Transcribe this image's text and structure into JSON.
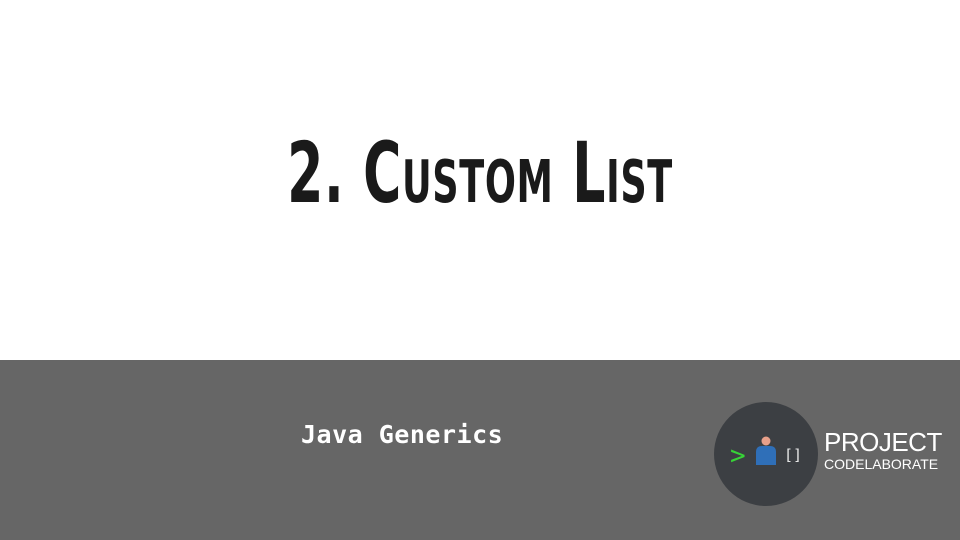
{
  "slide": {
    "title": "2. Custom List",
    "subtitle": "Java Generics"
  },
  "logo": {
    "word1": "PROJECT",
    "word2": "CODELABORATE",
    "glyph_prompt": ">",
    "glyph_brackets": "[]",
    "icons": [
      "prompt-chevron-icon",
      "person-icon",
      "brackets-icon"
    ]
  },
  "colors": {
    "background": "#ffffff",
    "title": "#1a1a1a",
    "footer_band": "#666666",
    "logo_circle": "#3c3f43",
    "prompt_green": "#37d437",
    "person_blue": "#2f6fb8",
    "person_skin": "#e8a08a"
  }
}
